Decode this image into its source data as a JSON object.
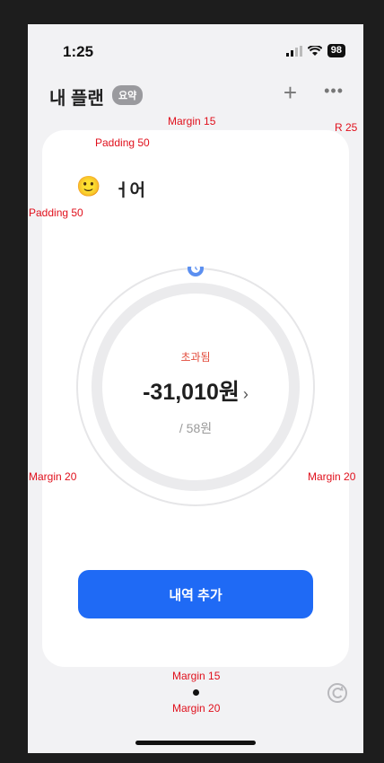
{
  "status_bar": {
    "time": "1:25",
    "battery": "98"
  },
  "nav": {
    "title": "내 플랜",
    "badge": "요약",
    "add_icon": "plus-icon",
    "more_icon": "ellipsis-icon"
  },
  "card": {
    "emoji": "🙂",
    "label": "ㅓ어",
    "status": "초과됨",
    "amount": "-31,010원",
    "budget": "/ 58원",
    "button_label": "내역 추가"
  },
  "annotations": {
    "margin_top": "Margin 15",
    "radius": "R 25",
    "padding_top": "Padding 50",
    "padding_left": "Padding 50",
    "margin_left": "Margin 20",
    "margin_right": "Margin 20",
    "margin_bottom_card": "Margin 15",
    "margin_bottom_dot": "Margin 20"
  },
  "colors": {
    "accent": "#1f6af5",
    "over": "#e24a3a",
    "card": "#ffffff",
    "background": "#f2f2f4"
  }
}
